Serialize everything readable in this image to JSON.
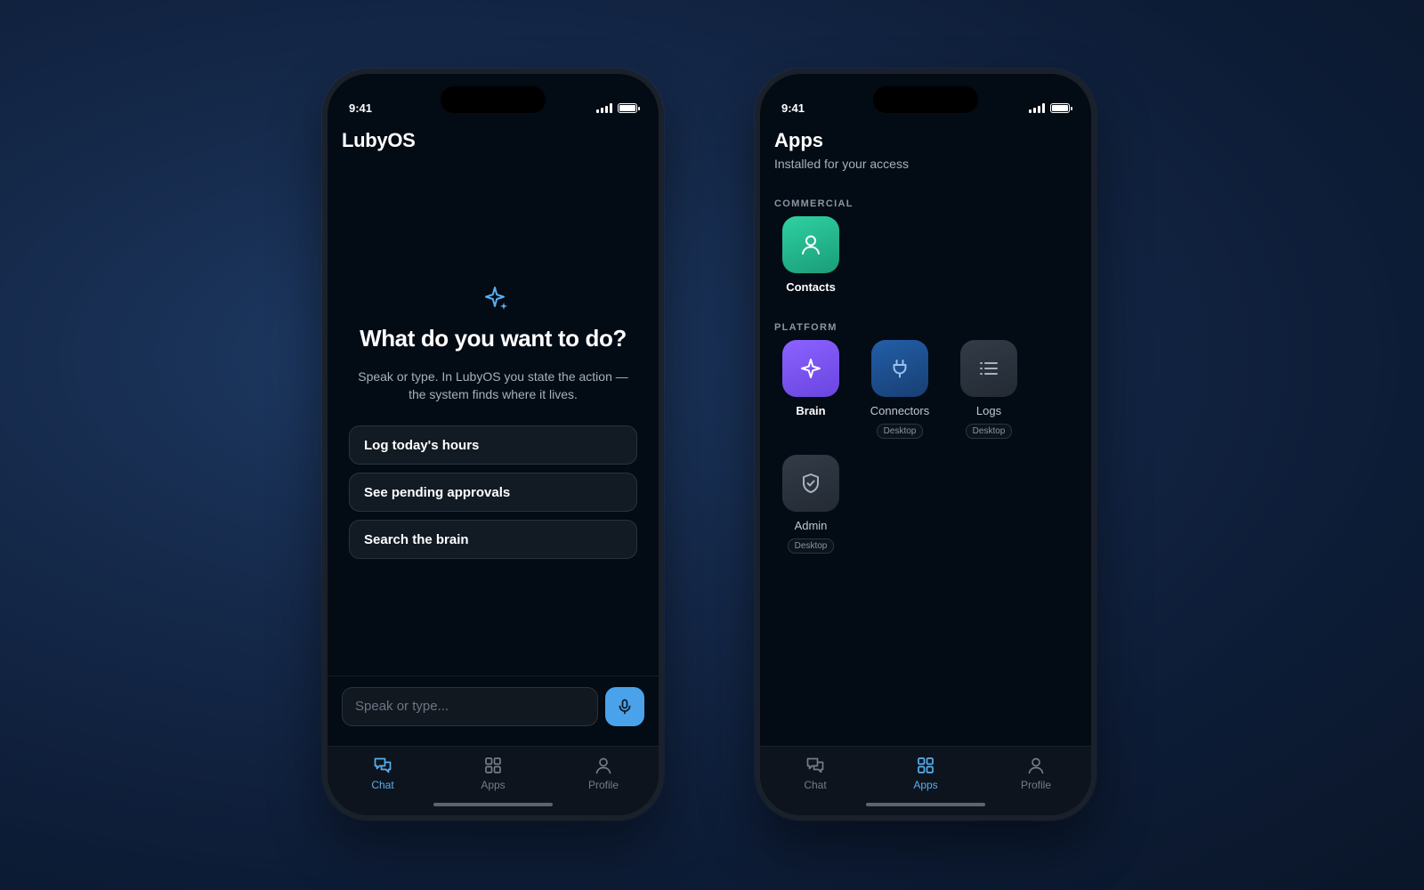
{
  "status": {
    "time": "9:41"
  },
  "chat": {
    "app_title": "LubyOS",
    "hero_title": "What do you want to do?",
    "hero_subtitle_line1": "Speak or type. In LubyOS you state the action —",
    "hero_subtitle_line2": "the system finds where it lives.",
    "suggestions": [
      "Log today's hours",
      "See pending approvals",
      "Search the brain"
    ],
    "composer_placeholder": "Speak or type..."
  },
  "apps": {
    "title": "Apps",
    "subtitle": "Installed for your access",
    "sections": [
      {
        "label": "COMMERCIAL",
        "items": [
          {
            "name": "Contacts",
            "icon": "person-icon",
            "color": "#22b48c"
          }
        ]
      },
      {
        "label": "PLATFORM",
        "items": [
          {
            "name": "Brain",
            "icon": "sparkle-icon",
            "color": "#7a55f2"
          },
          {
            "name": "Connectors",
            "icon": "plug-icon",
            "color": "#1d4f8f",
            "badge": "Desktop"
          },
          {
            "name": "Logs",
            "icon": "list-icon",
            "color": "#2a323d",
            "badge": "Desktop"
          },
          {
            "name": "Admin",
            "icon": "shield-check-icon",
            "color": "#2a323d",
            "badge": "Desktop"
          }
        ]
      }
    ]
  },
  "tabs": [
    {
      "label": "Chat",
      "icon": "chat-icon"
    },
    {
      "label": "Apps",
      "icon": "grid-icon"
    },
    {
      "label": "Profile",
      "icon": "person-icon"
    }
  ],
  "colors": {
    "accent": "#5aaef0",
    "mic": "#4aa3ea"
  }
}
